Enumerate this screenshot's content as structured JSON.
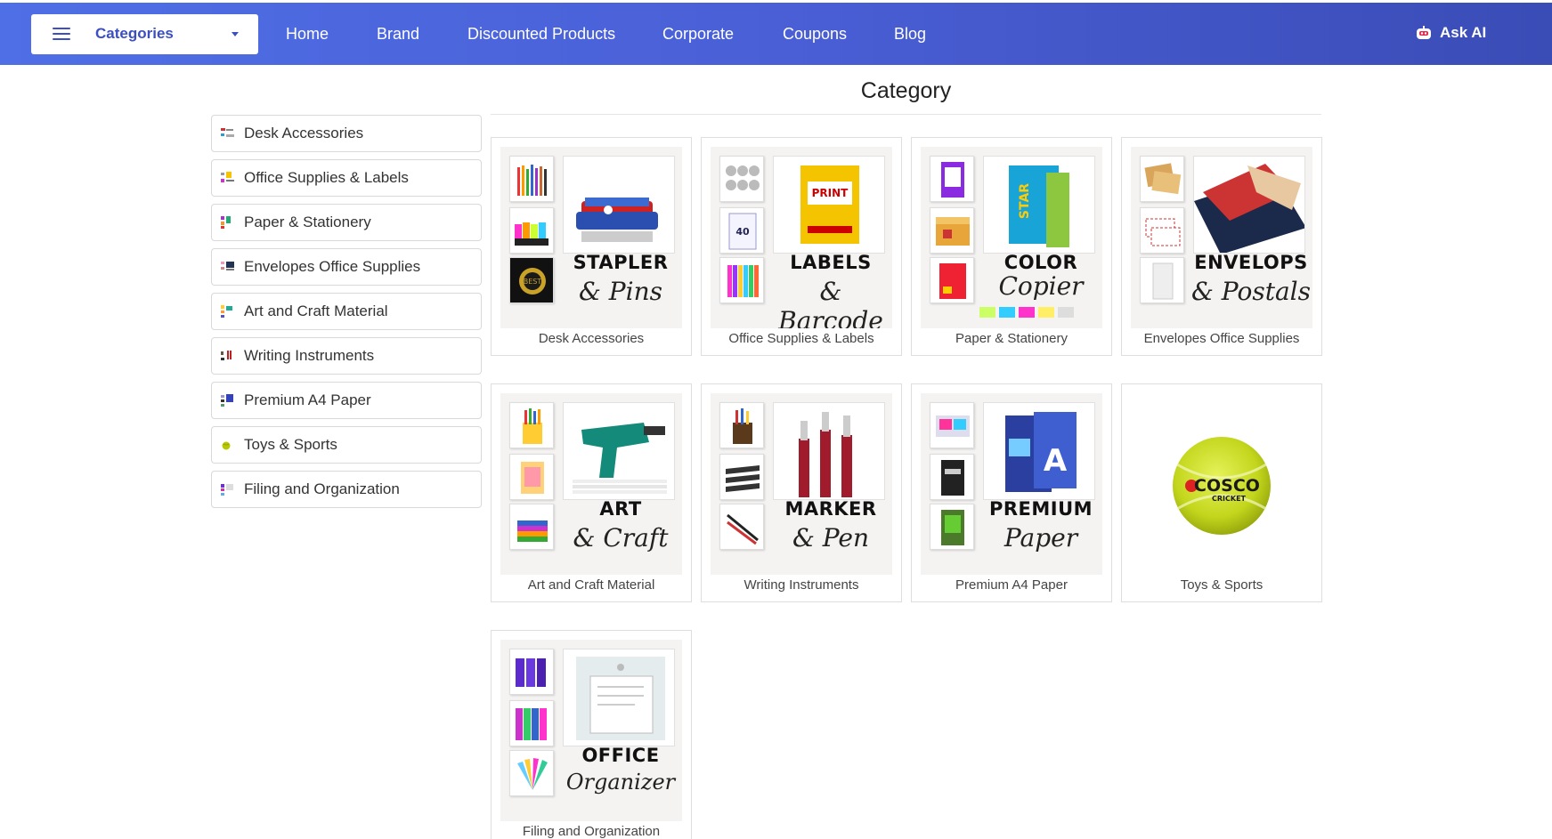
{
  "nav": {
    "categories_label": "Categories",
    "links": [
      "Home",
      "Brand",
      "Discounted Products",
      "Corporate",
      "Coupons",
      "Blog"
    ],
    "ask_ai": "Ask AI"
  },
  "page_title": "Category",
  "sidebar": {
    "items": [
      {
        "label": "Desk Accessories"
      },
      {
        "label": "Office Supplies & Labels"
      },
      {
        "label": "Paper & Stationery"
      },
      {
        "label": "Envelopes Office Supplies"
      },
      {
        "label": "Art and Craft Material"
      },
      {
        "label": "Writing Instruments"
      },
      {
        "label": "Premium A4 Paper"
      },
      {
        "label": "Toys & Sports"
      },
      {
        "label": "Filing and Organization"
      }
    ]
  },
  "cards": [
    {
      "label": "Desk Accessories",
      "big": "STAPLER",
      "script": "& Pins"
    },
    {
      "label": "Office Supplies & Labels",
      "big": "LABELS",
      "script": "& Barcode"
    },
    {
      "label": "Paper & Stationery",
      "big": "COLOR",
      "script": "Copier"
    },
    {
      "label": "Envelopes Office Supplies",
      "big": "ENVELOPS",
      "script": "& Postals"
    },
    {
      "label": "Art and Craft Material",
      "big": "ART",
      "script": "& Craft"
    },
    {
      "label": "Writing Instruments",
      "big": "MARKER",
      "script": "& Pen"
    },
    {
      "label": "Premium A4 Paper",
      "big": "PREMIUM",
      "script": "Paper"
    },
    {
      "label": "Toys & Sports",
      "ball_text": "COSCO",
      "ball_sub": "CRICKET"
    },
    {
      "label": "Filing and Organization",
      "big": "OFFICE",
      "script": "Organizer"
    }
  ],
  "colors": {
    "nav_start": "#4f6fe6",
    "nav_end": "#3a4cb6",
    "accent": "#3b4fc0"
  }
}
